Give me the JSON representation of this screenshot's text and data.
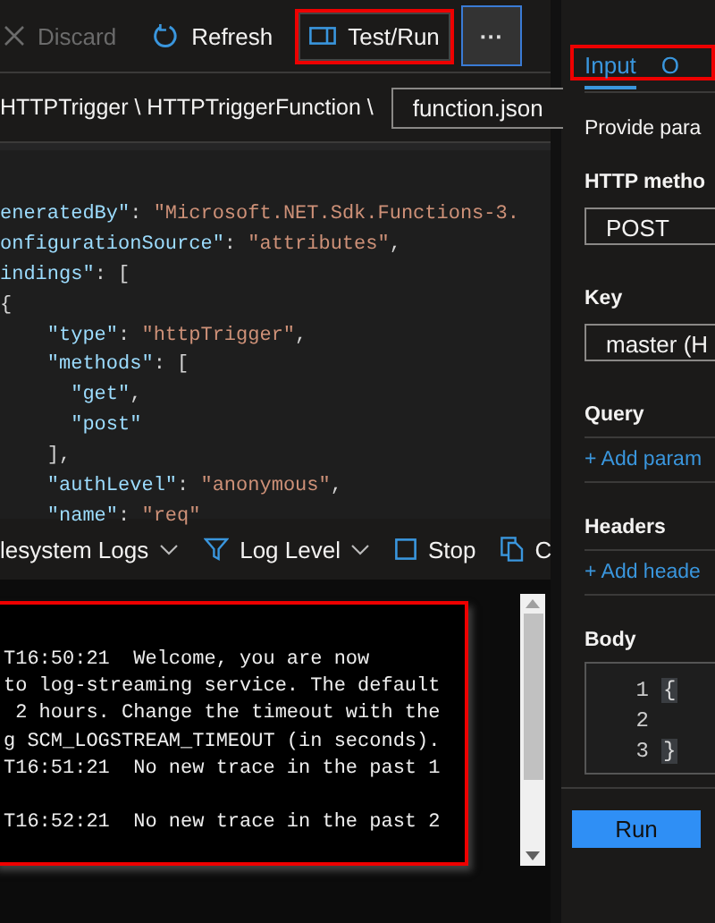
{
  "toolbar": {
    "buttons": [
      {
        "kind": "discard",
        "label": "Discard",
        "disabled": true,
        "highlighted": false
      },
      {
        "kind": "refresh",
        "label": "Refresh",
        "disabled": false,
        "highlighted": false
      },
      {
        "kind": "testrun",
        "label": "Test/Run",
        "disabled": false,
        "highlighted": true
      }
    ],
    "more": "···"
  },
  "breadcrumb": "HTTPTrigger \\ HTTPTriggerFunction \\",
  "file_select": {
    "value": "function.json"
  },
  "editor": {
    "lines": [
      [
        {
          "kind": "key",
          "text": "eneratedBy\""
        },
        {
          "kind": "punct",
          "text": ": "
        },
        {
          "kind": "string",
          "text": "\"Microsoft.NET.Sdk.Functions-3."
        }
      ],
      [
        {
          "kind": "key",
          "text": "onfigurationSource\""
        },
        {
          "kind": "punct",
          "text": ": "
        },
        {
          "kind": "string",
          "text": "\"attributes\""
        },
        {
          "kind": "punct",
          "text": ","
        }
      ],
      [
        {
          "kind": "key",
          "text": "indings\""
        },
        {
          "kind": "punct",
          "text": ": ["
        }
      ],
      [
        {
          "kind": "punct",
          "text": "{"
        }
      ],
      [
        {
          "kind": "key",
          "text": "    \"type\""
        },
        {
          "kind": "punct",
          "text": ": "
        },
        {
          "kind": "string",
          "text": "\"httpTrigger\""
        },
        {
          "kind": "punct",
          "text": ","
        }
      ],
      [
        {
          "kind": "key",
          "text": "    \"methods\""
        },
        {
          "kind": "punct",
          "text": ": ["
        }
      ],
      [
        {
          "kind": "key",
          "text": "      \"get\""
        },
        {
          "kind": "punct",
          "text": ","
        }
      ],
      [
        {
          "kind": "key",
          "text": "      \"post\""
        }
      ],
      [
        {
          "kind": "punct",
          "text": "    ],"
        }
      ],
      [
        {
          "kind": "key",
          "text": "    \"authLevel\""
        },
        {
          "kind": "punct",
          "text": ": "
        },
        {
          "kind": "string",
          "text": "\"anonymous\""
        },
        {
          "kind": "punct",
          "text": ","
        }
      ],
      [
        {
          "kind": "key",
          "text": "    \"name\""
        },
        {
          "kind": "punct",
          "text": ": "
        },
        {
          "kind": "string",
          "text": "\"req\""
        }
      ]
    ]
  },
  "log_toolbar": [
    {
      "kind": "source",
      "label": "lesystem Logs"
    },
    {
      "kind": "level",
      "label": "Log Level"
    },
    {
      "kind": "stop",
      "label": "Stop"
    },
    {
      "kind": "copy",
      "label": "C"
    }
  ],
  "log": {
    "highlighted": true,
    "lines": [
      "T16:50:21  Welcome, you are now",
      "to log-streaming service. The default",
      " 2 hours. Change the timeout with the",
      "g SCM_LOGSTREAM_TIMEOUT (in seconds).",
      "T16:51:21  No new trace in the past 1",
      "T16:52:21  No new trace in the past 2"
    ]
  },
  "panel": {
    "tabs_highlighted": true,
    "tabs": [
      {
        "label": "Input",
        "selected": true
      },
      {
        "label": "O",
        "selected": false
      }
    ],
    "description": "Provide para",
    "http_method": {
      "label": "HTTP metho",
      "value": "POST"
    },
    "key": {
      "label": "Key",
      "value": "master (H"
    },
    "query": {
      "label": "Query",
      "link": "+ Add param"
    },
    "headers": {
      "label": "Headers",
      "link": "+ Add heade"
    },
    "body": {
      "label": "Body",
      "lines": [
        {
          "number": "1",
          "text": "{"
        },
        {
          "number": "2"
        },
        {
          "number": "3",
          "text": "}"
        }
      ]
    },
    "run_button": "Run"
  }
}
